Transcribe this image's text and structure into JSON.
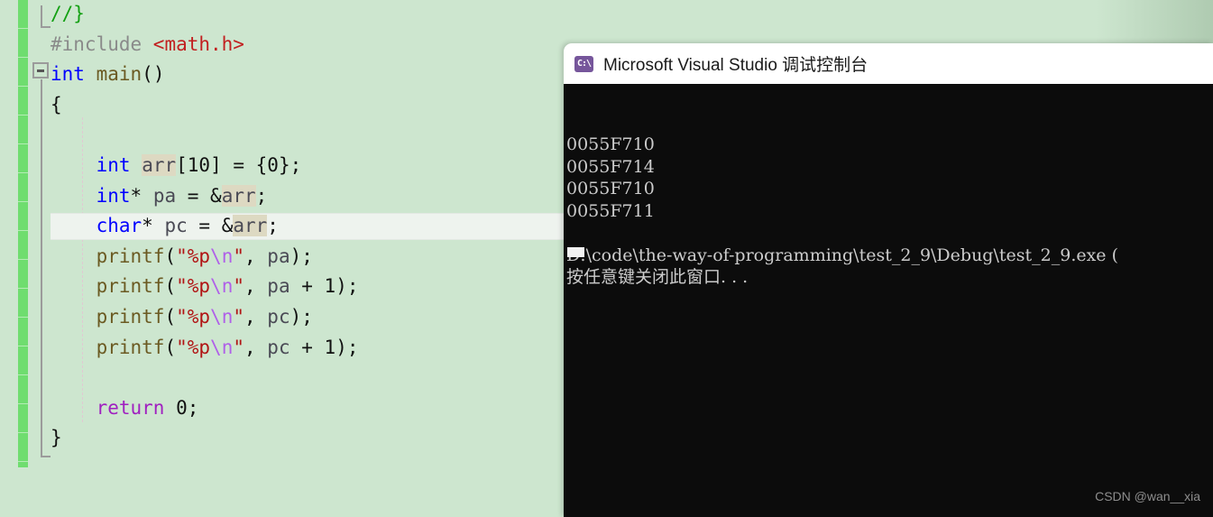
{
  "editor": {
    "name": "visual-studio-code-editor",
    "background_color": "#cde6cf",
    "change_bar_color": "#6fdd6f",
    "current_line_index": 6,
    "lines": [
      {
        "indent": 0,
        "tokens": [
          {
            "t": "//}",
            "c": "cmt"
          }
        ]
      },
      {
        "indent": 0,
        "tokens": [
          {
            "t": "#include ",
            "c": "pp"
          },
          {
            "t": "<math.h>",
            "c": "inc"
          }
        ]
      },
      {
        "indent": 0,
        "tokens": [
          {
            "t": "int",
            "c": "kw"
          },
          {
            "t": " ",
            "c": "punct"
          },
          {
            "t": "main",
            "c": "fn"
          },
          {
            "t": "()",
            "c": "punct"
          }
        ]
      },
      {
        "indent": 0,
        "tokens": [
          {
            "t": "{",
            "c": "brace"
          }
        ]
      },
      {
        "indent": 0,
        "tokens": []
      },
      {
        "indent": 2,
        "tokens": [
          {
            "t": "int",
            "c": "kw"
          },
          {
            "t": " ",
            "c": "punct"
          },
          {
            "t": "arr",
            "c": "id",
            "hl": true
          },
          {
            "t": "[",
            "c": "punct"
          },
          {
            "t": "10",
            "c": "num"
          },
          {
            "t": "] = {",
            "c": "punct"
          },
          {
            "t": "0",
            "c": "num"
          },
          {
            "t": "};",
            "c": "punct"
          }
        ]
      },
      {
        "indent": 2,
        "tokens": [
          {
            "t": "int",
            "c": "kw"
          },
          {
            "t": "* ",
            "c": "punct"
          },
          {
            "t": "pa",
            "c": "id"
          },
          {
            "t": " = &",
            "c": "punct"
          },
          {
            "t": "arr",
            "c": "id",
            "hl": true
          },
          {
            "t": ";",
            "c": "punct"
          }
        ]
      },
      {
        "indent": 2,
        "tokens": [
          {
            "t": "char",
            "c": "kw"
          },
          {
            "t": "* ",
            "c": "punct"
          },
          {
            "t": "pc",
            "c": "id"
          },
          {
            "t": " = &",
            "c": "punct"
          },
          {
            "t": "arr",
            "c": "id",
            "hl": true
          },
          {
            "t": ";",
            "c": "punct"
          }
        ]
      },
      {
        "indent": 2,
        "tokens": [
          {
            "t": "printf",
            "c": "fn"
          },
          {
            "t": "(",
            "c": "punct"
          },
          {
            "t": "\"%p",
            "c": "str"
          },
          {
            "t": "\\n",
            "c": "esc"
          },
          {
            "t": "\"",
            "c": "str"
          },
          {
            "t": ", ",
            "c": "punct"
          },
          {
            "t": "pa",
            "c": "id"
          },
          {
            "t": ");",
            "c": "punct"
          }
        ]
      },
      {
        "indent": 2,
        "tokens": [
          {
            "t": "printf",
            "c": "fn"
          },
          {
            "t": "(",
            "c": "punct"
          },
          {
            "t": "\"%p",
            "c": "str"
          },
          {
            "t": "\\n",
            "c": "esc"
          },
          {
            "t": "\"",
            "c": "str"
          },
          {
            "t": ", ",
            "c": "punct"
          },
          {
            "t": "pa",
            "c": "id"
          },
          {
            "t": " + ",
            "c": "punct"
          },
          {
            "t": "1",
            "c": "num"
          },
          {
            "t": ");",
            "c": "punct"
          }
        ]
      },
      {
        "indent": 2,
        "tokens": [
          {
            "t": "printf",
            "c": "fn"
          },
          {
            "t": "(",
            "c": "punct"
          },
          {
            "t": "\"%p",
            "c": "str"
          },
          {
            "t": "\\n",
            "c": "esc"
          },
          {
            "t": "\"",
            "c": "str"
          },
          {
            "t": ", ",
            "c": "punct"
          },
          {
            "t": "pc",
            "c": "id"
          },
          {
            "t": ");",
            "c": "punct"
          }
        ]
      },
      {
        "indent": 2,
        "tokens": [
          {
            "t": "printf",
            "c": "fn"
          },
          {
            "t": "(",
            "c": "punct"
          },
          {
            "t": "\"%p",
            "c": "str"
          },
          {
            "t": "\\n",
            "c": "esc"
          },
          {
            "t": "\"",
            "c": "str"
          },
          {
            "t": ", ",
            "c": "punct"
          },
          {
            "t": "pc",
            "c": "id"
          },
          {
            "t": " + ",
            "c": "punct"
          },
          {
            "t": "1",
            "c": "num"
          },
          {
            "t": ");",
            "c": "punct"
          }
        ]
      },
      {
        "indent": 0,
        "tokens": []
      },
      {
        "indent": 2,
        "tokens": [
          {
            "t": "return",
            "c": "kw2"
          },
          {
            "t": " ",
            "c": "punct"
          },
          {
            "t": "0",
            "c": "num"
          },
          {
            "t": ";",
            "c": "punct"
          }
        ]
      },
      {
        "indent": 0,
        "tokens": [
          {
            "t": "}",
            "c": "brace"
          }
        ]
      }
    ]
  },
  "console": {
    "icon": "cmd-console-icon",
    "icon_glyph": "C:\\",
    "title": "Microsoft Visual Studio 调试控制台",
    "background_color": "#0c0c0c",
    "text_color": "#cccccc",
    "output_lines": [
      "0055F710",
      "0055F714",
      "0055F710",
      "0055F711",
      "",
      "D:\\code\\the-way-of-programming\\test_2_9\\Debug\\test_2_9.exe (",
      "按任意键关闭此窗口. . ."
    ]
  },
  "watermark": {
    "text": "CSDN @wan__xia"
  }
}
